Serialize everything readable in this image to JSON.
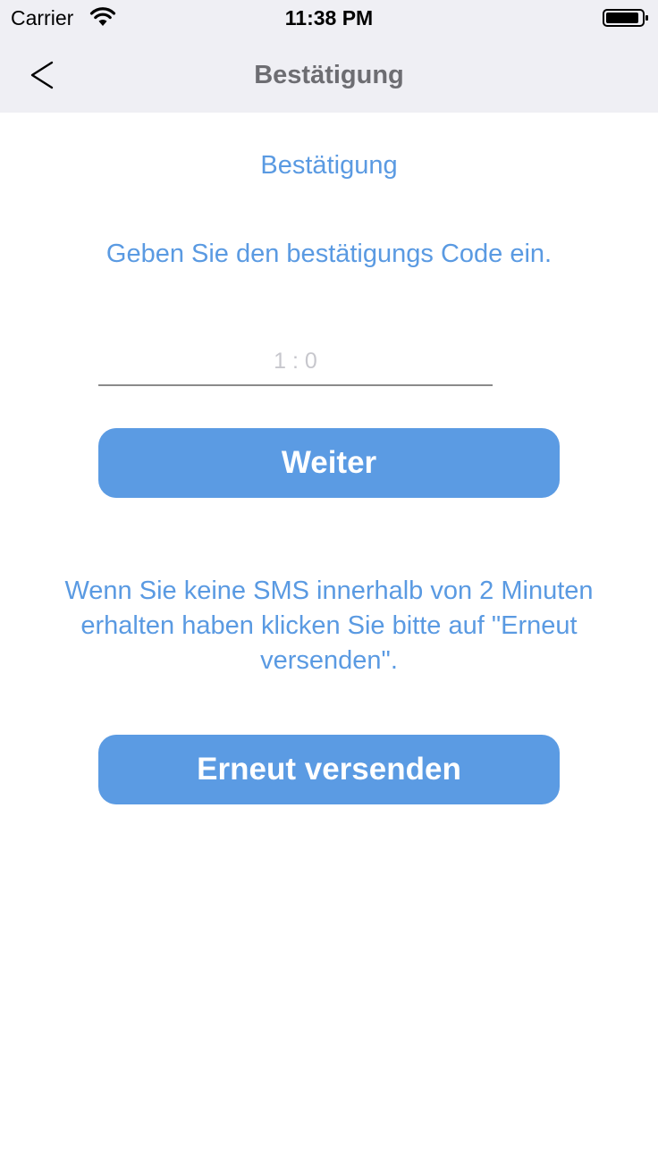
{
  "status_bar": {
    "carrier": "Carrier",
    "time": "11:38 PM",
    "wifi_icon": "wifi-icon",
    "battery_icon": "battery-icon"
  },
  "nav": {
    "back_icon": "chevron-left-icon",
    "title": "Bestätigung"
  },
  "main": {
    "title": "Bestätigung",
    "instruction": "Geben Sie den bestätigungs Code ein.",
    "code_input": {
      "value": "",
      "placeholder": "1 : 0"
    },
    "continue_label": "Weiter",
    "sms_info": "Wenn Sie keine SMS innerhalb von 2 Minuten erhalten haben klicken Sie bitte auf \"Erneut versenden\".",
    "resend_label": "Erneut versenden"
  },
  "colors": {
    "accent": "#5b9be3",
    "text_accent": "#5a9ae2",
    "nav_background": "#efeff4",
    "nav_title": "#6d6d72"
  }
}
